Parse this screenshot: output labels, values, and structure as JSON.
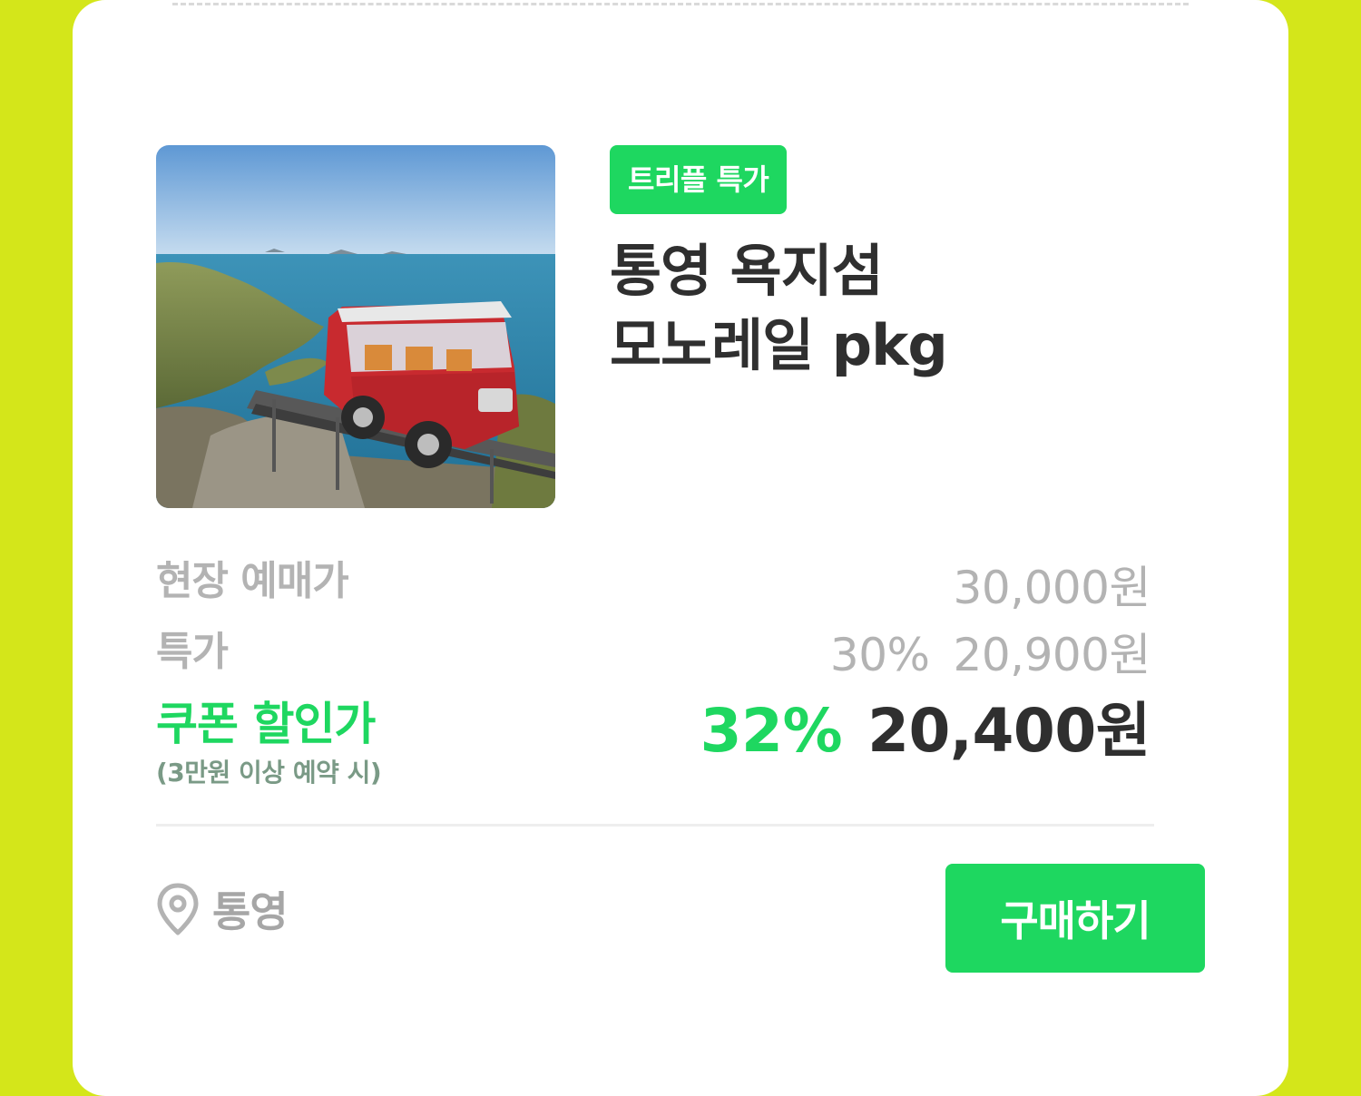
{
  "badge": "트리플 특가",
  "title": {
    "line1": "통영 욕지섬",
    "line2": "모노레일 pkg"
  },
  "prices": {
    "onsite": {
      "label": "현장 예매가",
      "amount": "30,000원"
    },
    "special": {
      "label": "특가",
      "discount": "30%",
      "amount": "20,900원"
    },
    "coupon": {
      "label": "쿠폰 할인가",
      "note": "(3만원 이상 예약 시)",
      "discount": "32%",
      "amount": "20,400원"
    }
  },
  "location": {
    "icon": "location-pin-icon",
    "name": "통영"
  },
  "buy_button": "구매하기",
  "colors": {
    "background": "#d4e61a",
    "accent": "#1ed760",
    "card": "#ffffff",
    "text_dark": "#2f2f2f",
    "text_muted": "#b3b3b3"
  }
}
